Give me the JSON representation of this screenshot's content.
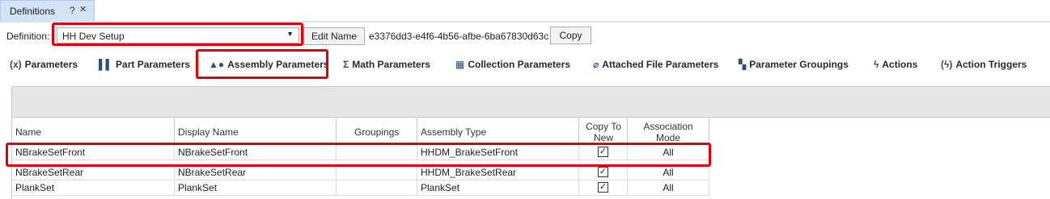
{
  "tab": {
    "title": "Definitions",
    "help": "?",
    "pin": "✕"
  },
  "definition": {
    "label": "Definition:",
    "selected": "HH Dev Setup",
    "edit_name_label": "Edit Name",
    "id": "e3376dd3-e4f6-4b56-afbe-6ba67830d63c",
    "copy_label": "Copy"
  },
  "toolbar": {
    "items": [
      {
        "label": "Parameters",
        "icon": "(x)"
      },
      {
        "label": "Part Parameters",
        "icon": "▌▌"
      },
      {
        "label": "Assembly Parameters",
        "icon": "▲●"
      },
      {
        "label": "Math Parameters",
        "icon": "Σ"
      },
      {
        "label": "Collection Parameters",
        "icon": "▦"
      },
      {
        "label": "Attached File Parameters",
        "icon": "⌀"
      },
      {
        "label": "Parameter Groupings",
        "icon": "▚"
      },
      {
        "label": "Actions",
        "icon": "ϟ"
      },
      {
        "label": "Action Triggers",
        "icon": "(ϟ)"
      }
    ]
  },
  "grid": {
    "columns": [
      "Name",
      "Display Name",
      "Groupings",
      "Assembly Type",
      "Copy To New",
      "Association Mode"
    ],
    "rows": [
      {
        "name": "NBrakeSetFront",
        "display_name": "NBrakeSetFront",
        "groupings": "",
        "assembly_type": "HHDM_BrakeSetFront",
        "copy_to_new": "✓",
        "association_mode": "All"
      },
      {
        "name": "NBrakeSetRear",
        "display_name": "NBrakeSetRear",
        "groupings": "",
        "assembly_type": "HHDM_BrakeSetRear",
        "copy_to_new": "✓",
        "association_mode": "All"
      },
      {
        "name": "PlankSet",
        "display_name": "PlankSet",
        "groupings": "",
        "assembly_type": "PlankSet",
        "copy_to_new": "✓",
        "association_mode": "All"
      }
    ]
  },
  "colors": {
    "highlight": "#e0000e",
    "tab_bg": "#d3e4f7",
    "icon": "#2e4f73"
  }
}
